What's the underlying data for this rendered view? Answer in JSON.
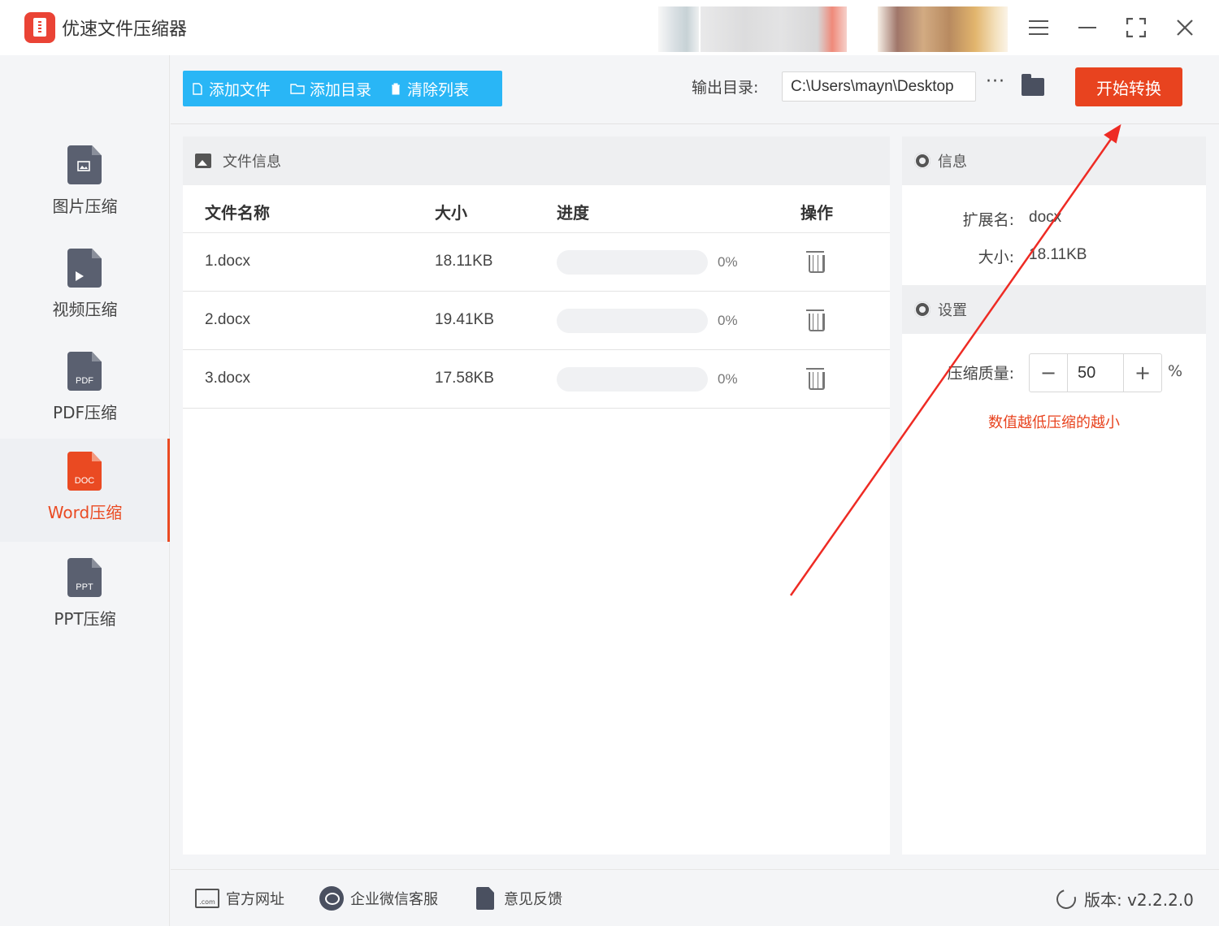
{
  "app": {
    "title": "优速文件压缩器"
  },
  "sidebar": {
    "items": [
      {
        "label": "图片压缩",
        "icon_text": ""
      },
      {
        "label": "视频压缩",
        "icon_text": ""
      },
      {
        "label": "PDF压缩",
        "icon_text": "PDF"
      },
      {
        "label": "Word压缩",
        "icon_text": "DOC"
      },
      {
        "label": "PPT压缩",
        "icon_text": "PPT"
      }
    ],
    "active": "Word压缩"
  },
  "toolbar": {
    "add_file": "添加文件",
    "add_dir": "添加目录",
    "clear_list": "清除列表",
    "output_label": "输出目录:",
    "output_path": "C:\\Users\\mayn\\Desktop",
    "more": "···",
    "start": "开始转换"
  },
  "file_panel": {
    "title": "文件信息",
    "columns": {
      "name": "文件名称",
      "size": "大小",
      "progress": "进度",
      "action": "操作"
    },
    "rows": [
      {
        "name": "1.docx",
        "size": "18.11KB",
        "progress": 0,
        "progress_text": "0%"
      },
      {
        "name": "2.docx",
        "size": "19.41KB",
        "progress": 0,
        "progress_text": "0%"
      },
      {
        "name": "3.docx",
        "size": "17.58KB",
        "progress": 0,
        "progress_text": "0%"
      }
    ]
  },
  "info_panel": {
    "info_title": "信息",
    "ext_label": "扩展名:",
    "ext_value": "docx",
    "size_label": "大小:",
    "size_value": "18.11KB",
    "settings_title": "设置",
    "quality_label": "压缩质量:",
    "quality_value": "50",
    "minus": "−",
    "plus": "+",
    "unit": "%",
    "hint": "数值越低压缩的越小"
  },
  "footer": {
    "website": "官方网址",
    "wechat": "企业微信客服",
    "feedback": "意见反馈",
    "version": "版本: v2.2.2.0",
    "com_icon_text": ".com"
  },
  "colors": {
    "accent": "#e8431f",
    "toolbar_blue": "#29b6f6",
    "annotation_arrow": "#ee2b24"
  }
}
